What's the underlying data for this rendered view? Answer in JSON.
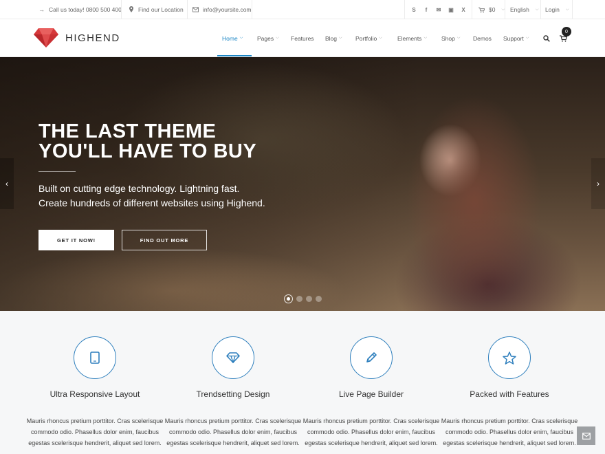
{
  "topbar": {
    "phone": "Call us today! 0800 500 400",
    "location": "Find our Location",
    "email": "info@yoursite.com",
    "cart_total": "$0",
    "language": "English",
    "login": "Login",
    "social_icons": [
      "skype-icon",
      "facebook-icon",
      "twitter-icon",
      "instagram-icon",
      "xing-icon"
    ]
  },
  "header": {
    "logo_text": "HIGHEND",
    "nav": [
      {
        "label": "Home",
        "dropdown": true,
        "active": true
      },
      {
        "label": "Pages",
        "dropdown": true
      },
      {
        "label": "Features",
        "dropdown": false
      },
      {
        "label": "Blog",
        "dropdown": true
      },
      {
        "label": "Portfolio",
        "dropdown": true
      },
      {
        "label": "Elements",
        "dropdown": true
      },
      {
        "label": "Shop",
        "dropdown": true
      },
      {
        "label": "Demos",
        "dropdown": false
      },
      {
        "label": "Support",
        "dropdown": true
      }
    ],
    "cart_count": "0",
    "accent_color": "#1b86c5"
  },
  "hero": {
    "title_line1": "THE LAST THEME",
    "title_line2": "YOU'LL HAVE TO BUY",
    "subtitle_line1": "Built on cutting edge technology. Lightning fast.",
    "subtitle_line2": "Create hundreds of different websites using Highend.",
    "button_primary": "GET IT NOW!",
    "button_secondary": "FIND OUT MORE",
    "slides_count": 4,
    "active_slide": 1
  },
  "features": [
    {
      "icon": "tablet-icon",
      "title": "Ultra Responsive Layout",
      "text": "Mauris rhoncus pretium porttitor. Cras scelerisque commodo odio. Phasellus dolor enim, faucibus egestas scelerisque hendrerit, aliquet sed lorem."
    },
    {
      "icon": "diamond-icon",
      "title": "Trendsetting Design",
      "text": "Mauris rhoncus pretium porttitor. Cras scelerisque commodo odio. Phasellus dolor enim, faucibus egestas scelerisque hendrerit, aliquet sed lorem."
    },
    {
      "icon": "pencil-icon",
      "title": "Live Page Builder",
      "text": "Mauris rhoncus pretium porttitor. Cras scelerisque commodo odio. Phasellus dolor enim, faucibus egestas scelerisque hendrerit, aliquet sed lorem."
    },
    {
      "icon": "star-icon",
      "title": "Packed with Features",
      "text": "Mauris rhoncus pretium porttitor. Cras scelerisque commodo odio. Phasellus dolor enim, faucibus egestas scelerisque hendrerit, aliquet sed lorem."
    }
  ],
  "floating_button_icon": "mail-icon"
}
